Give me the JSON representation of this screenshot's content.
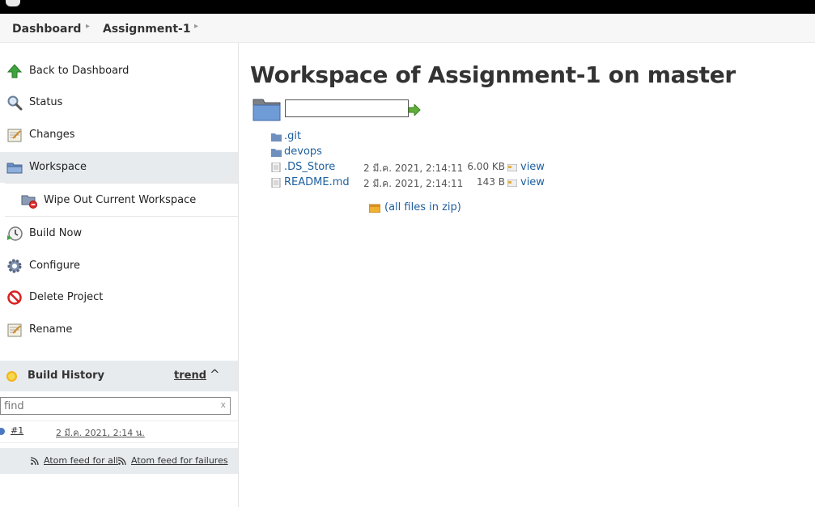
{
  "breadcrumbs": [
    {
      "label": "Dashboard"
    },
    {
      "label": "Assignment-1"
    }
  ],
  "sidebar": {
    "tasks": [
      {
        "label": "Back to Dashboard",
        "icon": "up-arrow-icon"
      },
      {
        "label": "Status",
        "icon": "magnifier-icon"
      },
      {
        "label": "Changes",
        "icon": "notepad-icon"
      },
      {
        "label": "Workspace",
        "icon": "folder-icon",
        "active": true
      },
      {
        "label": "Wipe Out Current Workspace",
        "icon": "wipe-workspace-icon"
      },
      {
        "label": "Build Now",
        "icon": "clock-play-icon"
      },
      {
        "label": "Configure",
        "icon": "gear-icon"
      },
      {
        "label": "Delete Project",
        "icon": "no-entry-icon"
      },
      {
        "label": "Rename",
        "icon": "notepad-icon"
      }
    ]
  },
  "build_history": {
    "title": "Build History",
    "trend_label": "trend",
    "collapse_glyph": "^",
    "find_placeholder": "find",
    "find_clear": "x",
    "builds": [
      {
        "number": "#1",
        "date": "2 มี.ค. 2021, 2:14 น."
      }
    ],
    "feed_all": "Atom feed for all",
    "feed_failures": "Atom feed for failures"
  },
  "main": {
    "title": "Workspace of Assignment-1 on master",
    "path_value": "",
    "files": [
      {
        "name": ".git",
        "type": "folder",
        "date": "",
        "size": "",
        "view": ""
      },
      {
        "name": "devops",
        "type": "folder",
        "date": "",
        "size": "",
        "view": ""
      },
      {
        "name": ".DS_Store",
        "type": "file",
        "date": "2 มี.ค. 2021, 2:14:11",
        "size": "6.00 KB",
        "view": "view"
      },
      {
        "name": "README.md",
        "type": "file",
        "date": "2 มี.ค. 2021, 2:14:11",
        "size": "143 B",
        "view": "view"
      }
    ],
    "zip_label": "(all files in zip)"
  },
  "colors": {
    "link": "#1d5f9f",
    "active_bg": "#e8ebee",
    "header_bg": "#000000"
  }
}
